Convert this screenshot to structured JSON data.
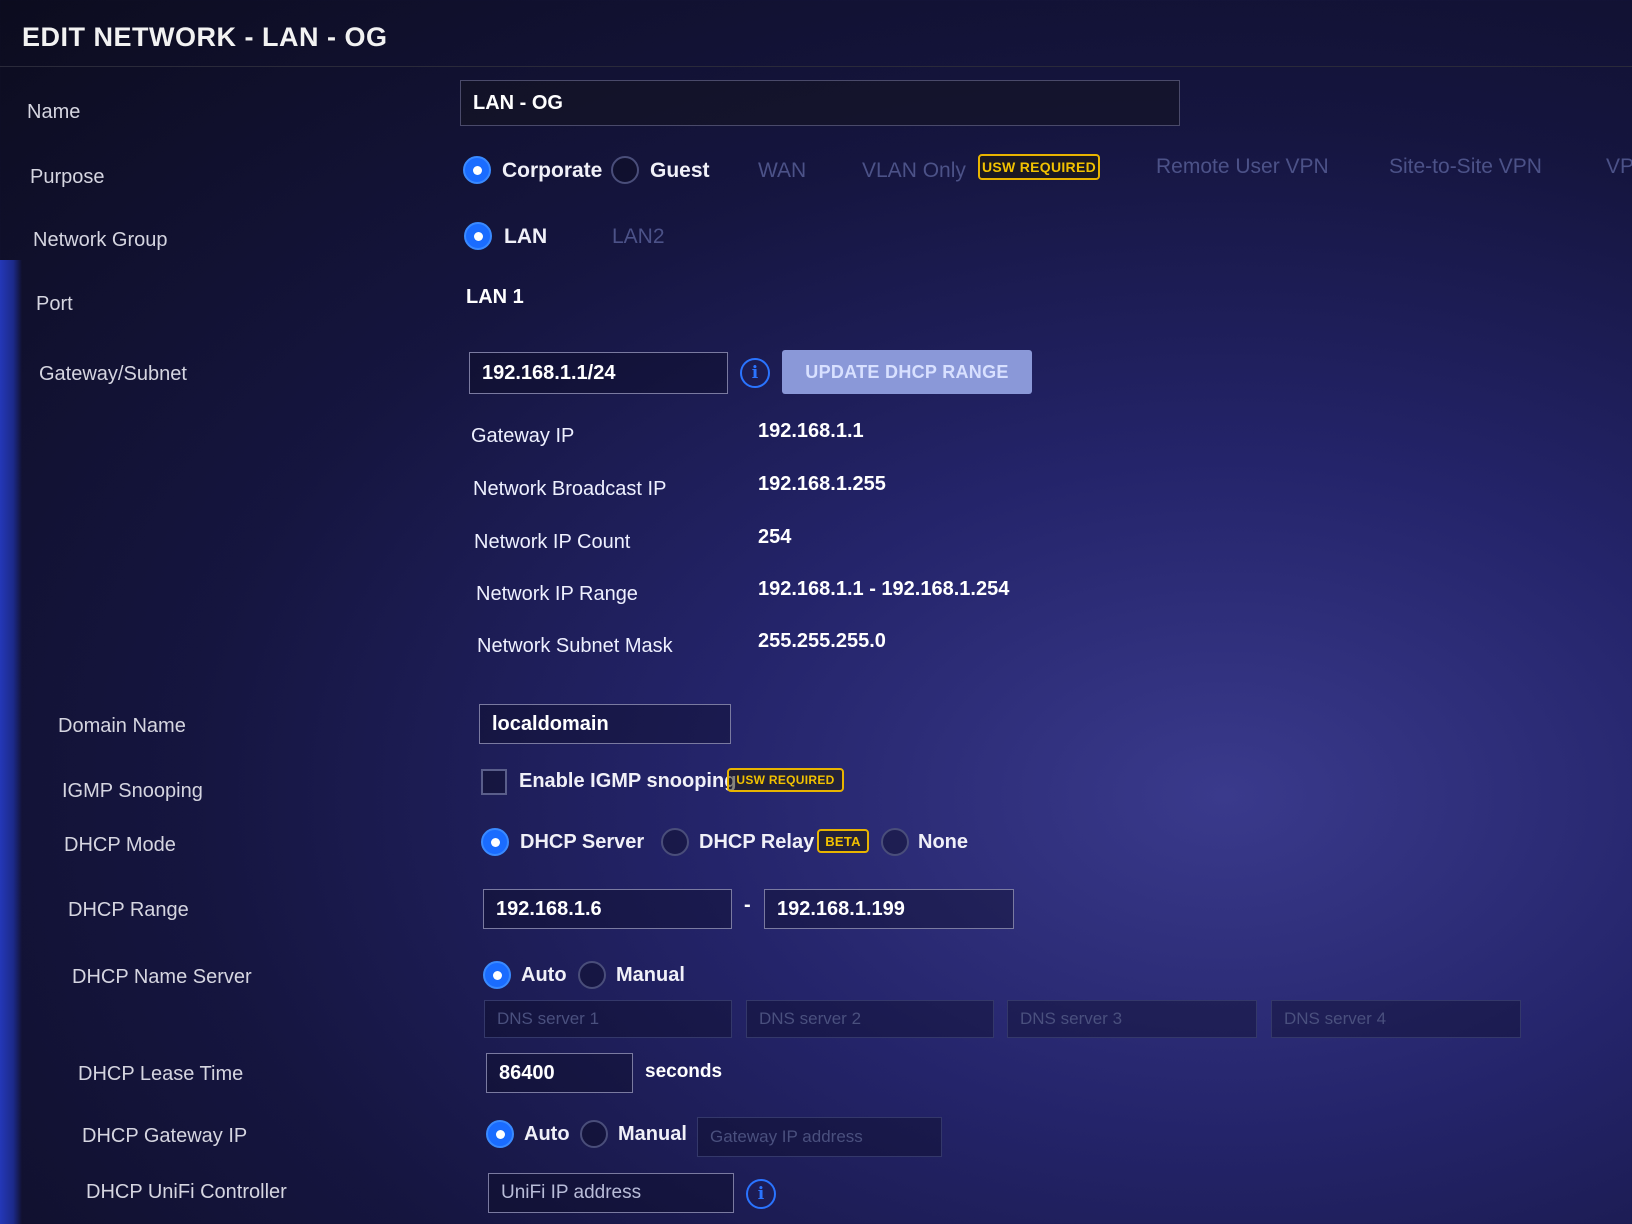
{
  "title": "EDIT NETWORK - LAN - OG",
  "fields": {
    "name": {
      "label": "Name",
      "value": "LAN - OG"
    },
    "purpose": {
      "label": "Purpose",
      "options": [
        "Corporate",
        "Guest",
        "WAN",
        "VLAN Only",
        "Remote User VPN",
        "Site-to-Site VPN",
        "VP"
      ],
      "selected": "Corporate",
      "vlan_badge": "USW REQUIRED"
    },
    "network_group": {
      "label": "Network Group",
      "options": [
        "LAN",
        "LAN2"
      ],
      "selected": "LAN"
    },
    "port": {
      "label": "Port",
      "value": "LAN 1"
    },
    "gateway_subnet": {
      "label": "Gateway/Subnet",
      "value": "192.168.1.1/24",
      "button": "UPDATE DHCP RANGE"
    },
    "subnet_info": {
      "gateway_ip": {
        "label": "Gateway IP",
        "value": "192.168.1.1"
      },
      "broadcast_ip": {
        "label": "Network Broadcast IP",
        "value": "192.168.1.255"
      },
      "ip_count": {
        "label": "Network IP Count",
        "value": "254"
      },
      "ip_range": {
        "label": "Network IP Range",
        "value": "192.168.1.1 - 192.168.1.254"
      },
      "subnet_mask": {
        "label": "Network Subnet Mask",
        "value": "255.255.255.0"
      }
    },
    "domain_name": {
      "label": "Domain Name",
      "value": "localdomain"
    },
    "igmp": {
      "label": "IGMP Snooping",
      "checkbox_label": "Enable IGMP snooping",
      "checked": false,
      "badge": "USW REQUIRED"
    },
    "dhcp_mode": {
      "label": "DHCP Mode",
      "options": [
        "DHCP Server",
        "DHCP Relay",
        "None"
      ],
      "selected": "DHCP Server",
      "relay_badge": "BETA"
    },
    "dhcp_range": {
      "label": "DHCP Range",
      "start": "192.168.1.6",
      "separator": "-",
      "end": "192.168.1.199"
    },
    "dhcp_name_server": {
      "label": "DHCP Name Server",
      "options": [
        "Auto",
        "Manual"
      ],
      "selected": "Auto",
      "dns_placeholders": [
        "DNS server 1",
        "DNS server 2",
        "DNS server 3",
        "DNS server 4"
      ]
    },
    "dhcp_lease_time": {
      "label": "DHCP Lease Time",
      "value": "86400",
      "unit": "seconds"
    },
    "dhcp_gateway_ip": {
      "label": "DHCP Gateway IP",
      "options": [
        "Auto",
        "Manual"
      ],
      "selected": "Auto",
      "placeholder": "Gateway IP address"
    },
    "dhcp_unifi_controller": {
      "label": "DHCP UniFi Controller",
      "placeholder": "UniFi IP address"
    }
  },
  "colors": {
    "accent": "#1a6cff",
    "badge": "#e8b400",
    "background": "#1b1b4a"
  },
  "icons": {
    "info": "info-circle-icon"
  }
}
